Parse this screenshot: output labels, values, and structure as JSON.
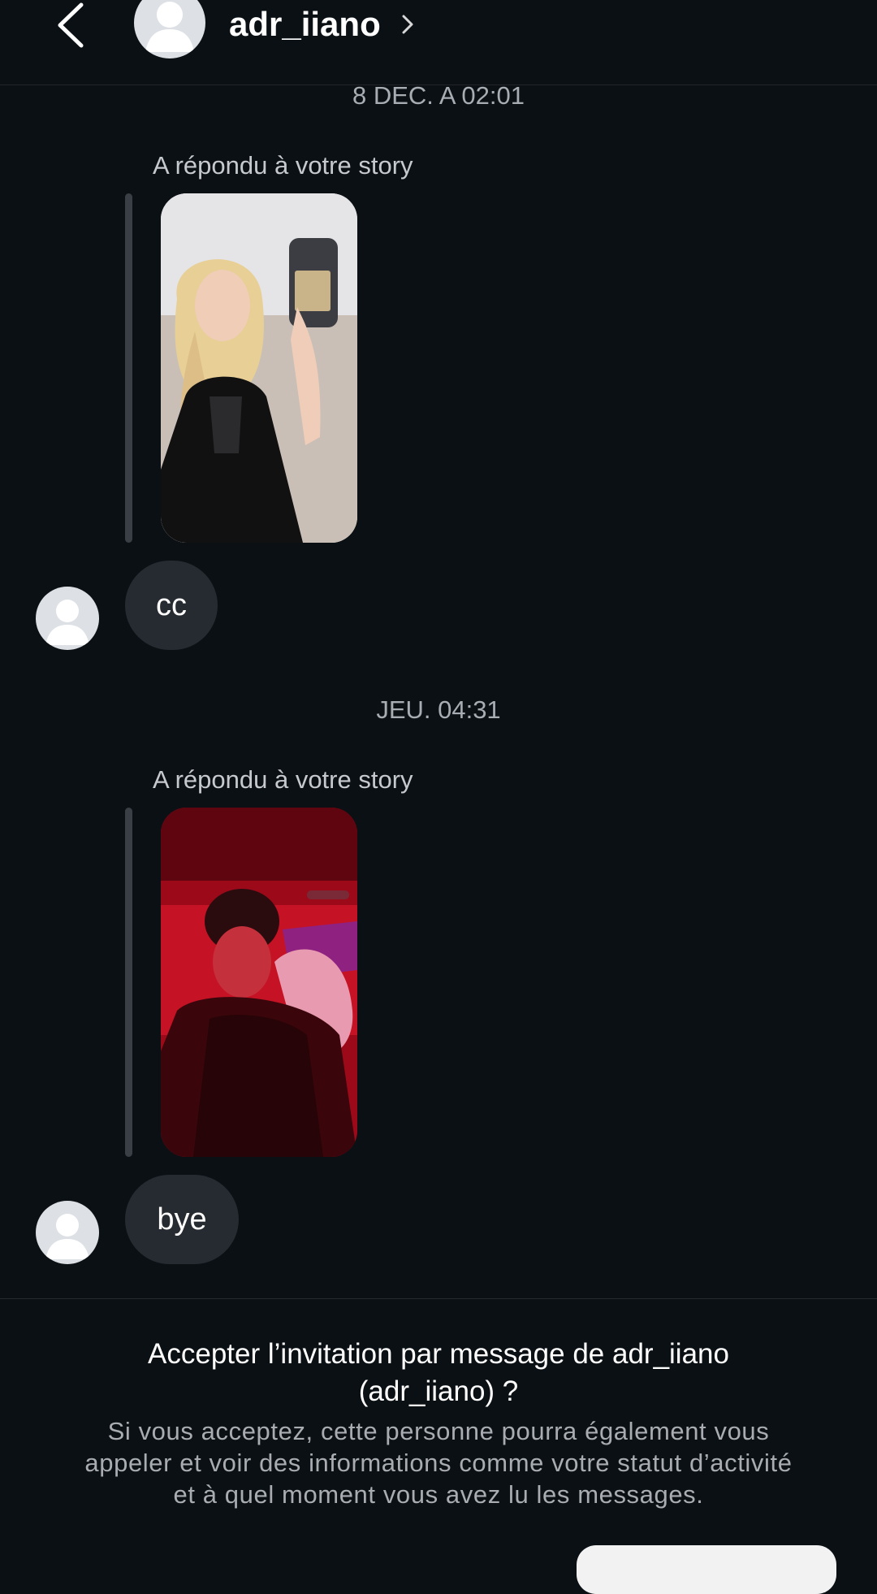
{
  "header": {
    "username": "adr_iiano"
  },
  "thread": {
    "timestamp_1": "8 DEC. A 02:01",
    "reply_label_1": "A répondu à votre story",
    "message_1": "cc",
    "timestamp_2": "JEU. 04:31",
    "reply_label_2": "A répondu à votre story",
    "message_2": "bye"
  },
  "invite": {
    "title_line_1": "Accepter l’invitation par message de adr_iiano",
    "title_line_2": "(adr_iiano) ?",
    "desc_line_1": "Si vous acceptez, cette personne pourra également vous",
    "desc_line_2": "appeler et voir des informations comme votre statut d’activité",
    "desc_line_3": "et à quel moment vous avez lu les messages."
  },
  "colors": {
    "background": "#0b1015",
    "bubble": "#262b31",
    "secondary_text": "#a8adb3"
  },
  "icons": {
    "back": "chevron-left-icon",
    "profile": "chevron-right-icon",
    "avatar": "default-avatar-icon"
  }
}
